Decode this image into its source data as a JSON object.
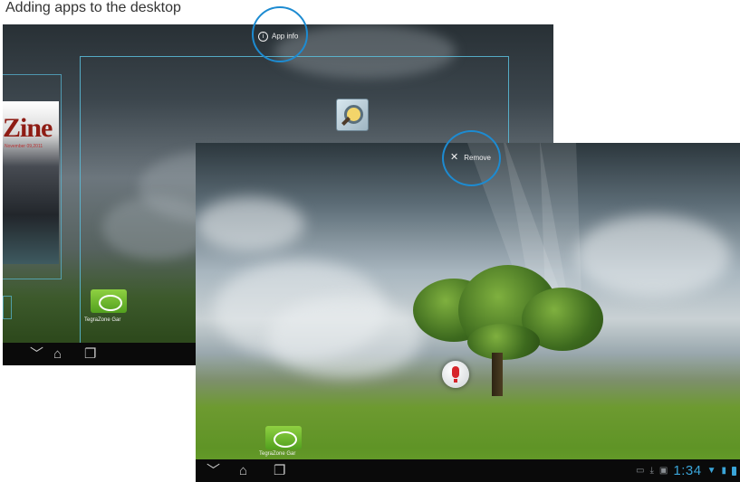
{
  "caption": "Adding apps to the desktop",
  "back_screen": {
    "magazine_title": "Zine",
    "magazine_subtitle": "November 09,2011",
    "app_info_label": "App info",
    "app_info_glyph": "i",
    "tile_label": "TegraZone Gar",
    "nav": {
      "back_glyph": "﹀",
      "home_glyph": "⌂",
      "recents_glyph": "❐"
    }
  },
  "front_screen": {
    "remove_label": "Remove",
    "remove_glyph": "✕",
    "tile_label": "TegraZone Gar",
    "nav": {
      "back_glyph": "﹀",
      "home_glyph": "⌂",
      "recents_glyph": "❐"
    },
    "status": {
      "clock": "1:34"
    }
  },
  "colors": {
    "highlight": "#1d8bd1",
    "clock": "#3aa4d8",
    "frame": "#5abedc"
  }
}
